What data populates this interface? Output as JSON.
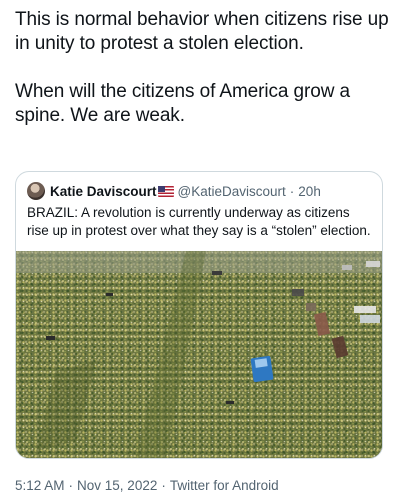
{
  "tweet": {
    "paragraphs": [
      "This is normal behavior when citizens rise up in unity to protest a stolen election.",
      "When will the citizens of America grow a spine. We are weak."
    ]
  },
  "quoted_tweet": {
    "display_name": "Katie Daviscourt",
    "handle": "@KatieDaviscourt",
    "separator": "·",
    "age": "20h",
    "text": "BRAZIL: A revolution is currently underway as citizens rise up in protest over what they say is a “stolen” election.",
    "flag_icon": "us-flag-icon"
  },
  "meta": {
    "time": "5:12 AM",
    "separator": "·",
    "date": "Nov 15, 2022",
    "client": "Twitter for Android"
  }
}
